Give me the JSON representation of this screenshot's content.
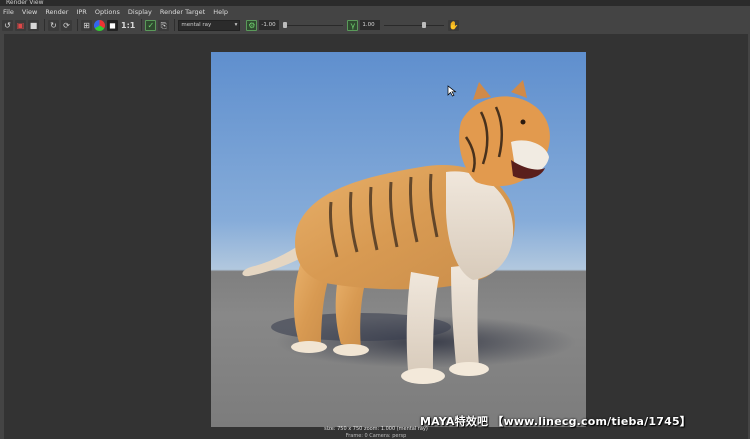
{
  "window": {
    "title": "Render View"
  },
  "menu": [
    "File",
    "View",
    "Render",
    "IPR",
    "Options",
    "Display",
    "Render Target",
    "Help"
  ],
  "toolbar": {
    "ratio_label": "1:1",
    "renderer": "mental ray",
    "exposure_value": "-1.00",
    "gamma_value": "1.00"
  },
  "render_info": {
    "size_line": "size: 750 x 750 zoom: 1.000        (mental ray)",
    "frame_line": "Frame: 0       Camera: persp"
  },
  "watermark": "MAYA特效吧 【www.linecg.com/tieba/1745】",
  "colors": {
    "sky": "#5f8fce",
    "floor": "#808080",
    "panel": "#444444",
    "viewport": "#333333"
  },
  "icons": [
    "redo-previous-render-icon",
    "render-region-icon",
    "snapshot-icon",
    "ipr-icon",
    "refresh-icon",
    "rgb-channels-icon",
    "alpha-icon",
    "real-size-icon",
    "keep-image-icon",
    "remove-image-icon",
    "color-mgmt-icon",
    "exposure-icon",
    "gamma-icon"
  ]
}
